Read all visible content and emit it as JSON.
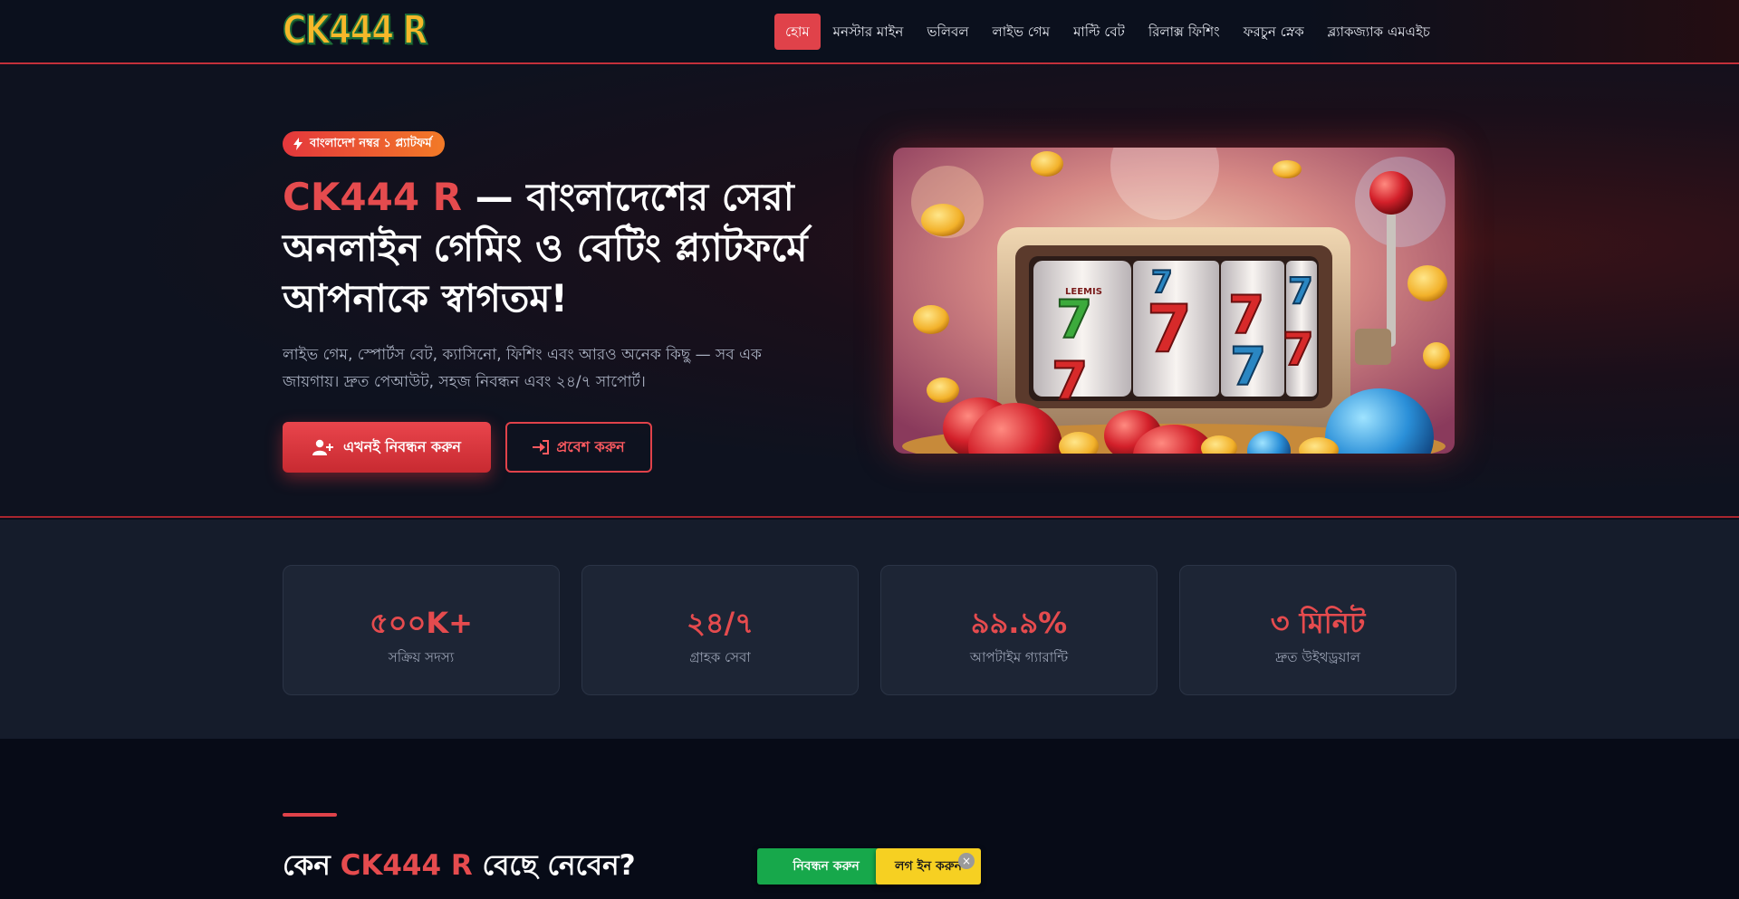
{
  "header": {
    "logo_text": "CK444 R",
    "nav": [
      {
        "label": "হোম",
        "active": true
      },
      {
        "label": "মনস্টার মাইন",
        "active": false
      },
      {
        "label": "ভলিবল",
        "active": false
      },
      {
        "label": "লাইভ গেম",
        "active": false
      },
      {
        "label": "মাল্টি বেট",
        "active": false
      },
      {
        "label": "রিলাক্স ফিশিং",
        "active": false
      },
      {
        "label": "ফরচুন স্নেক",
        "active": false
      },
      {
        "label": "ব্ল্যাকজ্যাক এমএইচ",
        "active": false
      }
    ]
  },
  "hero": {
    "badge": "বাংলাদেশ নম্বর ১ প্ল্যাটফর্ম",
    "title_brand": "CK444 R",
    "title_rest": " — বাংলাদেশের সেরা অনলাইন গেমিং ও বেটিং প্ল্যাটফর্মে আপনাকে স্বাগতম!",
    "description": "লাইভ গেম, স্পোর্টস বেট, ক্যাসিনো, ফিশিং এবং আরও অনেক কিছু — সব এক জায়গায়। দ্রুত পেআউট, সহজ নিবন্ধন এবং ২৪/৭ সাপোর্ট।",
    "register_button": "এখনই নিবন্ধন করুন",
    "login_button": "প্রবেশ করুন",
    "image_reel_label": "LEEMIS"
  },
  "stats": [
    {
      "value": "৫০০K+",
      "label": "সক্রিয় সদস্য"
    },
    {
      "value": "২৪/৭",
      "label": "গ্রাহক সেবা"
    },
    {
      "value": "৯৯.৯%",
      "label": "আপটাইম গ্যারান্টি"
    },
    {
      "value": "৩ মিনিট",
      "label": "দ্রুত উইথড্রয়াল"
    }
  ],
  "why": {
    "title_prefix": "কেন ",
    "title_brand": "CK444 R",
    "title_suffix": " বেছে নেবেন?"
  },
  "floating": {
    "register": "নিবন্ধন করুন",
    "login": "লগ ইন করুন",
    "close": "×"
  },
  "colors": {
    "accent": "#e0424a",
    "brand_text": "#e54b4e",
    "register_green": "#17a84b",
    "login_yellow": "#f6d022"
  }
}
